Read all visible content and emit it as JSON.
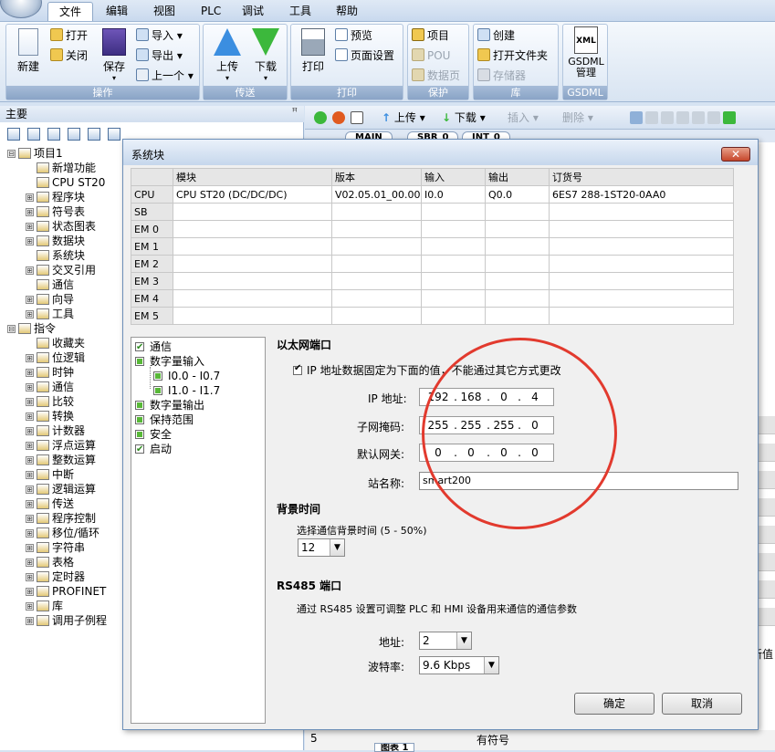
{
  "menu": {
    "items": [
      "文件",
      "编辑",
      "视图",
      "PLC",
      "调试",
      "工具",
      "帮助"
    ],
    "active": "文件"
  },
  "ribbon": {
    "groups": [
      {
        "label": "操作",
        "big": [
          "新建",
          "保存"
        ],
        "small": [
          "打开",
          "关闭",
          "导入",
          "导出",
          "上一个"
        ]
      },
      {
        "label": "传送",
        "big": [
          "上传",
          "下载"
        ]
      },
      {
        "label": "打印",
        "big": [
          "打印"
        ],
        "small": [
          "预览",
          "页面设置"
        ]
      },
      {
        "label": "保护",
        "small": [
          "项目",
          "POU",
          "数据页"
        ]
      },
      {
        "label": "库",
        "small": [
          "创建",
          "打开文件夹",
          "存储器"
        ]
      },
      {
        "label": "GSDML",
        "big": [
          "GSDML管理"
        ],
        "icon_text": "XML"
      }
    ]
  },
  "left_pane": {
    "title": "主要",
    "pin": "ꟸ",
    "tree": [
      {
        "label": "项目1",
        "level": 0,
        "toggle": "⊟"
      },
      {
        "label": "新增功能",
        "level": 1
      },
      {
        "label": "CPU ST20",
        "level": 1
      },
      {
        "label": "程序块",
        "level": 1,
        "toggle": "⊞"
      },
      {
        "label": "符号表",
        "level": 1,
        "toggle": "⊞"
      },
      {
        "label": "状态图表",
        "level": 1,
        "toggle": "⊞"
      },
      {
        "label": "数据块",
        "level": 1,
        "toggle": "⊞"
      },
      {
        "label": "系统块",
        "level": 1
      },
      {
        "label": "交叉引用",
        "level": 1,
        "toggle": "⊞"
      },
      {
        "label": "通信",
        "level": 1
      },
      {
        "label": "向导",
        "level": 1,
        "toggle": "⊞"
      },
      {
        "label": "工具",
        "level": 1,
        "toggle": "⊞"
      },
      {
        "label": "指令",
        "level": 0,
        "toggle": "⊟"
      },
      {
        "label": "收藏夹",
        "level": 1
      },
      {
        "label": "位逻辑",
        "level": 1,
        "toggle": "⊞"
      },
      {
        "label": "时钟",
        "level": 1,
        "toggle": "⊞"
      },
      {
        "label": "通信",
        "level": 1,
        "toggle": "⊞"
      },
      {
        "label": "比较",
        "level": 1,
        "toggle": "⊞"
      },
      {
        "label": "转换",
        "level": 1,
        "toggle": "⊞"
      },
      {
        "label": "计数器",
        "level": 1,
        "toggle": "⊞"
      },
      {
        "label": "浮点运算",
        "level": 1,
        "toggle": "⊞"
      },
      {
        "label": "整数运算",
        "level": 1,
        "toggle": "⊞"
      },
      {
        "label": "中断",
        "level": 1,
        "toggle": "⊞"
      },
      {
        "label": "逻辑运算",
        "level": 1,
        "toggle": "⊞"
      },
      {
        "label": "传送",
        "level": 1,
        "toggle": "⊞"
      },
      {
        "label": "程序控制",
        "level": 1,
        "toggle": "⊞"
      },
      {
        "label": "移位/循环",
        "level": 1,
        "toggle": "⊞"
      },
      {
        "label": "字符串",
        "level": 1,
        "toggle": "⊞"
      },
      {
        "label": "表格",
        "level": 1,
        "toggle": "⊞"
      },
      {
        "label": "定时器",
        "level": 1,
        "toggle": "⊞"
      },
      {
        "label": "PROFINET",
        "level": 1,
        "toggle": "⊞"
      },
      {
        "label": "库",
        "level": 1,
        "toggle": "⊞"
      },
      {
        "label": "调用子例程",
        "level": 1,
        "toggle": "⊞"
      }
    ]
  },
  "editor": {
    "toolbar": {
      "upload": "上传",
      "download": "下载",
      "insert": "插入",
      "delete": "删除"
    },
    "tabs": [
      "MAIN",
      "SBR_0",
      "INT_0"
    ],
    "bottom": {
      "row_num": "5",
      "col_text": "有符号",
      "tab": "图表 1"
    },
    "right_partial": "新值"
  },
  "dialog": {
    "title": "系统块",
    "close": "✕",
    "table": {
      "headers": [
        "",
        "模块",
        "版本",
        "输入",
        "输出",
        "订货号"
      ],
      "rows": [
        [
          "CPU",
          "CPU ST20 (DC/DC/DC)",
          "V02.05.01_00.00...",
          "I0.0",
          "Q0.0",
          "6ES7 288-1ST20-0AA0"
        ],
        [
          "SB",
          "",
          "",
          "",
          "",
          ""
        ],
        [
          "EM 0",
          "",
          "",
          "",
          "",
          ""
        ],
        [
          "EM 1",
          "",
          "",
          "",
          "",
          ""
        ],
        [
          "EM 2",
          "",
          "",
          "",
          "",
          ""
        ],
        [
          "EM 3",
          "",
          "",
          "",
          "",
          ""
        ],
        [
          "EM 4",
          "",
          "",
          "",
          "",
          ""
        ],
        [
          "EM 5",
          "",
          "",
          "",
          "",
          ""
        ]
      ]
    },
    "options": [
      {
        "label": "通信",
        "level": 0,
        "state": "checked"
      },
      {
        "label": "数字量输入",
        "level": 0,
        "state": "green"
      },
      {
        "label": "I0.0 - I0.7",
        "level": 1,
        "state": "green"
      },
      {
        "label": "I1.0 - I1.7",
        "level": 1,
        "state": "green"
      },
      {
        "label": "数字量输出",
        "level": 0,
        "state": "green"
      },
      {
        "label": "保持范围",
        "level": 0,
        "state": "green"
      },
      {
        "label": "安全",
        "level": 0,
        "state": "green"
      },
      {
        "label": "启动",
        "level": 0,
        "state": "checked"
      }
    ],
    "ethernet": {
      "heading": "以太网端口",
      "fixed_ip_label": "IP 地址数据固定为下面的值，不能通过其它方式更改",
      "ip_label": "IP 地址:",
      "ip": [
        "192",
        "168",
        "0",
        "4"
      ],
      "subnet_label": "子网掩码:",
      "subnet": [
        "255",
        "255",
        "255",
        "0"
      ],
      "gateway_label": "默认网关:",
      "gateway": [
        "0",
        "0",
        "0",
        "0"
      ],
      "station_label": "站名称:",
      "station_name": "smart200"
    },
    "background": {
      "heading": "背景时间",
      "label": "选择通信背景时间 (5 - 50%)",
      "value": "12"
    },
    "rs485": {
      "heading": "RS485 端口",
      "desc": "通过 RS485 设置可调整 PLC 和 HMI 设备用来通信的通信参数",
      "address_label": "地址:",
      "address": "2",
      "baud_label": "波特率:",
      "baud": "9.6 Kbps"
    },
    "buttons": {
      "ok": "确定",
      "cancel": "取消"
    }
  },
  "colors": {
    "accent": "#4a76b0",
    "annotation_red": "#e23a2e",
    "ribbon_label": "#8aa4c6"
  }
}
